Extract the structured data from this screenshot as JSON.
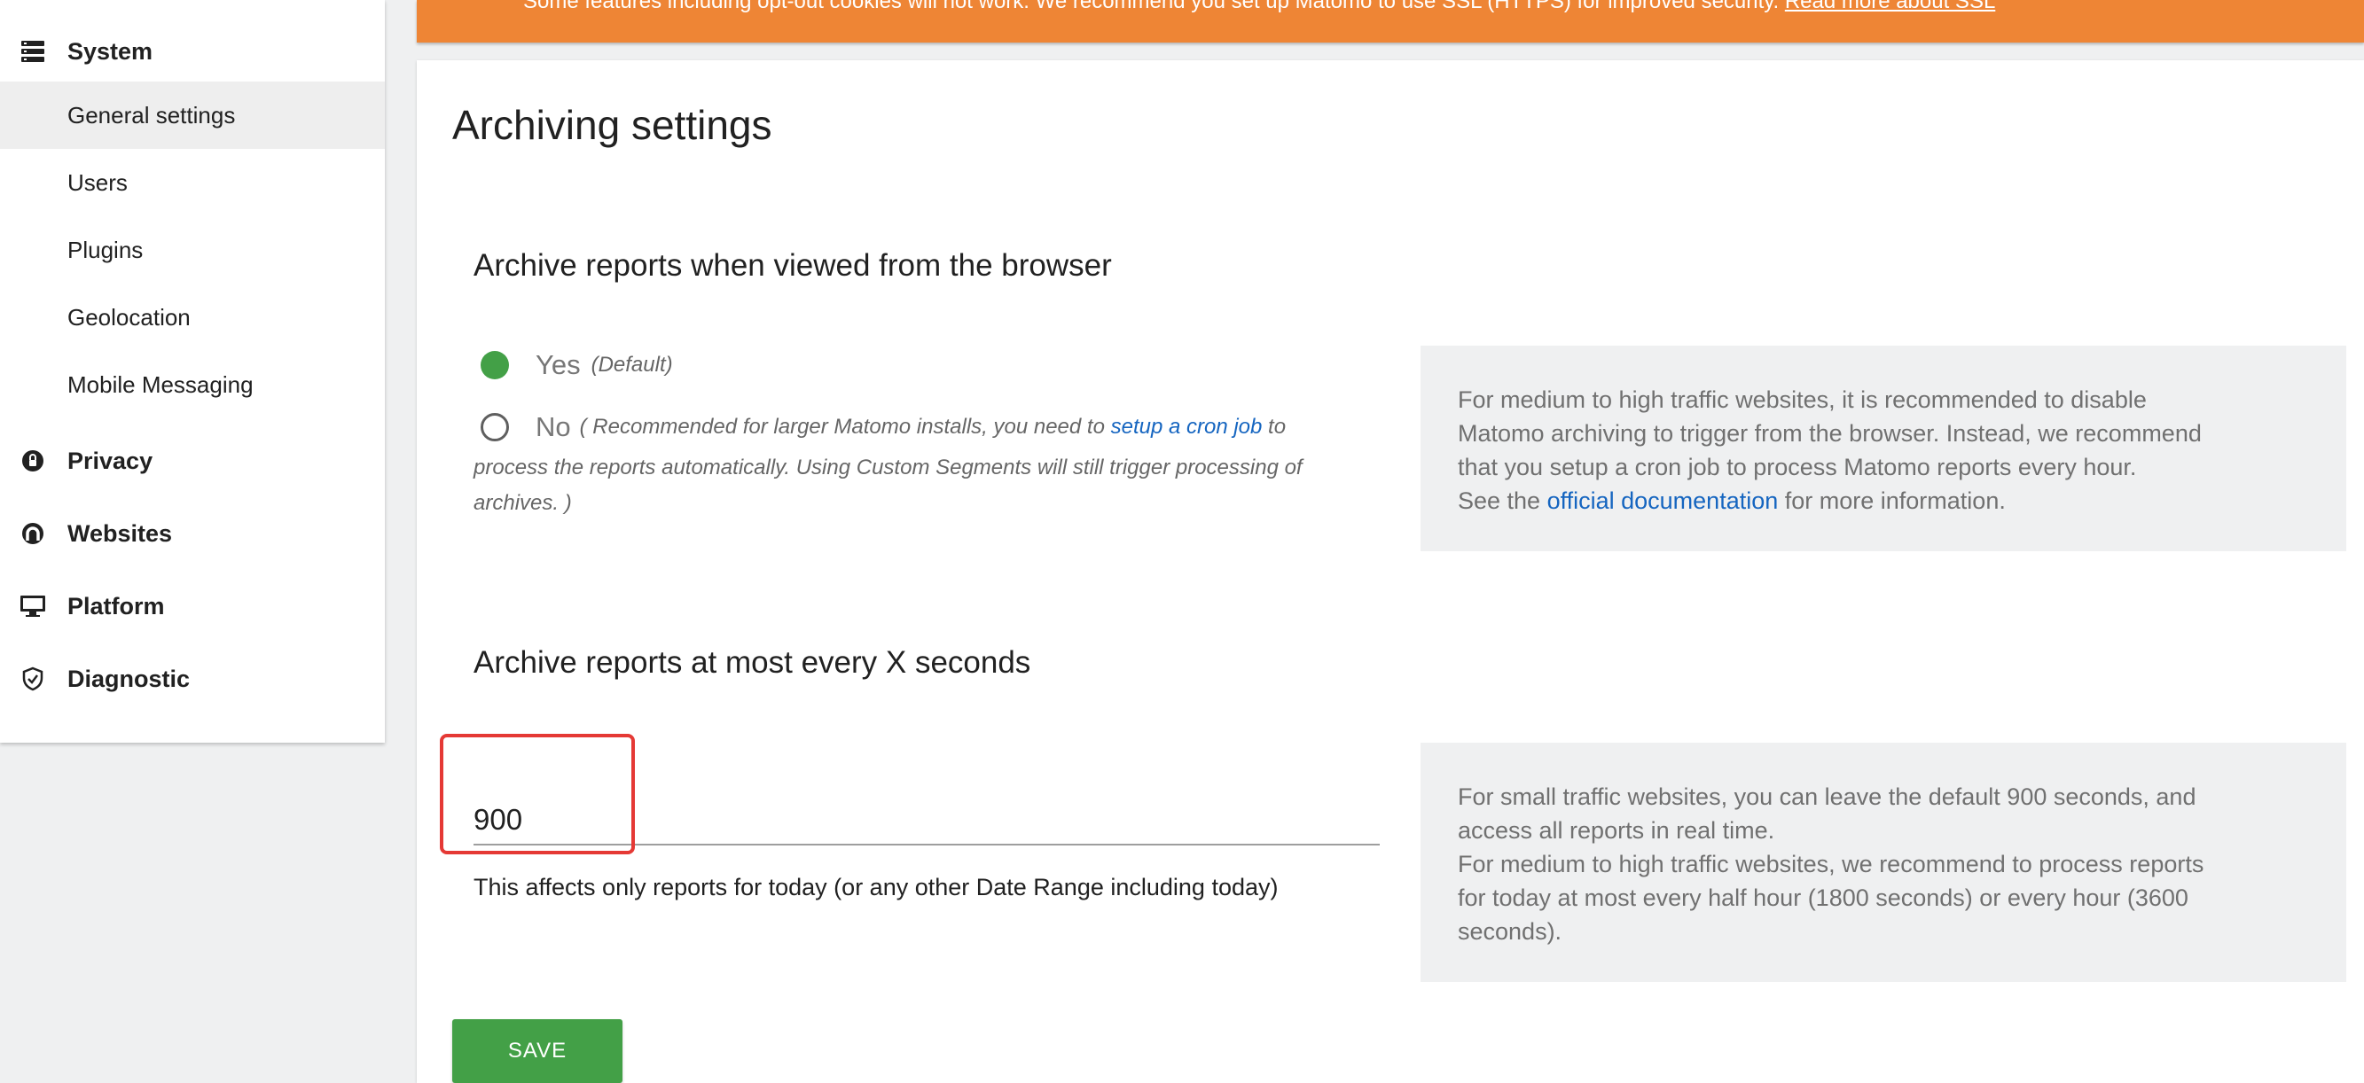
{
  "sidebar": {
    "sections": {
      "system": {
        "label": "System",
        "icon": "server-icon"
      },
      "privacy": {
        "label": "Privacy",
        "icon": "privacy-icon"
      },
      "websites": {
        "label": "Websites",
        "icon": "websites-icon"
      },
      "platform": {
        "label": "Platform",
        "icon": "monitor-icon"
      },
      "diagnostic": {
        "label": "Diagnostic",
        "icon": "shield-check-icon"
      }
    },
    "system_items": [
      {
        "label": "General settings",
        "active": true
      },
      {
        "label": "Users"
      },
      {
        "label": "Plugins"
      },
      {
        "label": "Geolocation"
      },
      {
        "label": "Mobile Messaging"
      }
    ]
  },
  "banner": {
    "text": "Some features including opt-out cookies will not work. We recommend you set up Matomo to use SSL (HTTPS) for improved security.",
    "link": "Read more about SSL"
  },
  "main": {
    "title": "Archiving settings",
    "browser_archiving": {
      "title": "Archive reports when viewed from the browser",
      "options": [
        {
          "label": "Yes",
          "note": "(Default)",
          "checked": true
        },
        {
          "label": "No",
          "note_before": "( Recommended for larger Matomo installs, you need to ",
          "note_link": "setup a cron job",
          "note_after": " to",
          "note_continued": "process the reports automatically. Using Custom Segments will still trigger processing of",
          "note_end": "archives. )"
        }
      ],
      "help": {
        "line1": "For medium to high traffic websites, it is recommended to disable",
        "line2": "Matomo archiving to trigger from the browser. Instead, we recommend",
        "line3": "that you setup a cron job to process Matomo reports every hour.",
        "line4_before": "See the ",
        "line4_link": "official documentation",
        "line4_after": " for more information."
      }
    },
    "archive_interval": {
      "title": "Archive reports at most every X seconds",
      "value": "900",
      "inline_help": "This affects only reports for today (or any other Date Range including today)",
      "help": {
        "line1": "For small traffic websites, you can leave the default 900 seconds, and",
        "line2": "access all reports in real time.",
        "line3": "For medium to high traffic websites, we recommend to process reports",
        "line4": "for today at most every half hour (1800 seconds) or every hour (3600",
        "line5": "seconds)."
      }
    },
    "save_label": "SAVE"
  },
  "colors": {
    "accent": "#43a047",
    "banner": "#ee8535",
    "link": "#1565c0",
    "highlight": "#e53935"
  }
}
